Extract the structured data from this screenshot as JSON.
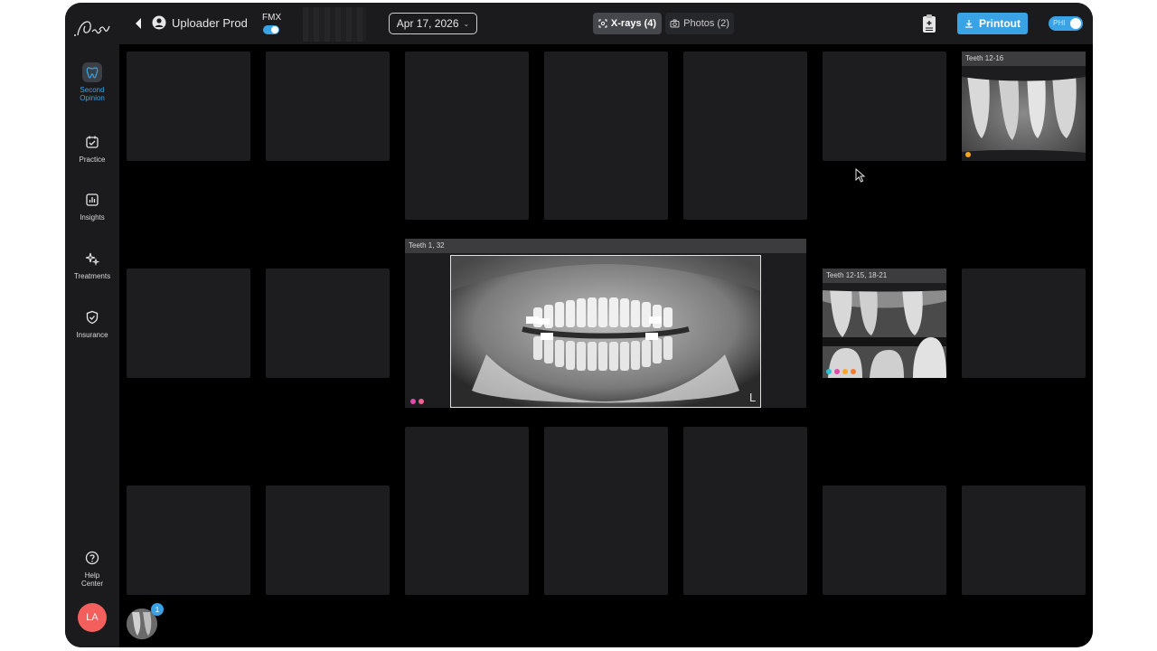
{
  "sidebar": {
    "items": [
      {
        "label_line1": "Second",
        "label_line2": "Opinion",
        "icon": "tooth-icon",
        "active": true
      },
      {
        "label_line1": "Practice",
        "label_line2": "",
        "icon": "calendar-check-icon"
      },
      {
        "label_line1": "Insights",
        "label_line2": "",
        "icon": "bar-chart-icon"
      },
      {
        "label_line1": "Treatments",
        "label_line2": "",
        "icon": "sparkle-icon"
      },
      {
        "label_line1": "Insurance",
        "label_line2": "",
        "icon": "shield-check-icon"
      }
    ],
    "help": {
      "label_line1": "Help",
      "label_line2": "Center"
    },
    "avatar": "LA",
    "badge_count": "1"
  },
  "header": {
    "uploader": "Uploader Prod",
    "fmx_label": "FMX",
    "date": "Apr 17, 2026",
    "tabs": [
      {
        "label": "X-rays (4)",
        "active": true
      },
      {
        "label": "Photos (2)",
        "active": false
      }
    ],
    "printout_label": "Printout",
    "phi_label": "PHI"
  },
  "xrays": [
    {
      "label": "Teeth 12-16",
      "dots": [
        "#f5a623"
      ]
    },
    {
      "label": "Teeth 1, 32",
      "dots": [
        "#e04aa8",
        "#f06292"
      ]
    },
    {
      "label": "Teeth 12-15, 18-21",
      "dots": [
        "#29c5d6",
        "#e04aa8",
        "#f5a623",
        "#f57c2b"
      ]
    },
    {
      "label": "L",
      "dots": []
    }
  ],
  "colors": {
    "accent": "#3aa3e6",
    "slot": "#1d1d1f",
    "background": "#000000"
  }
}
